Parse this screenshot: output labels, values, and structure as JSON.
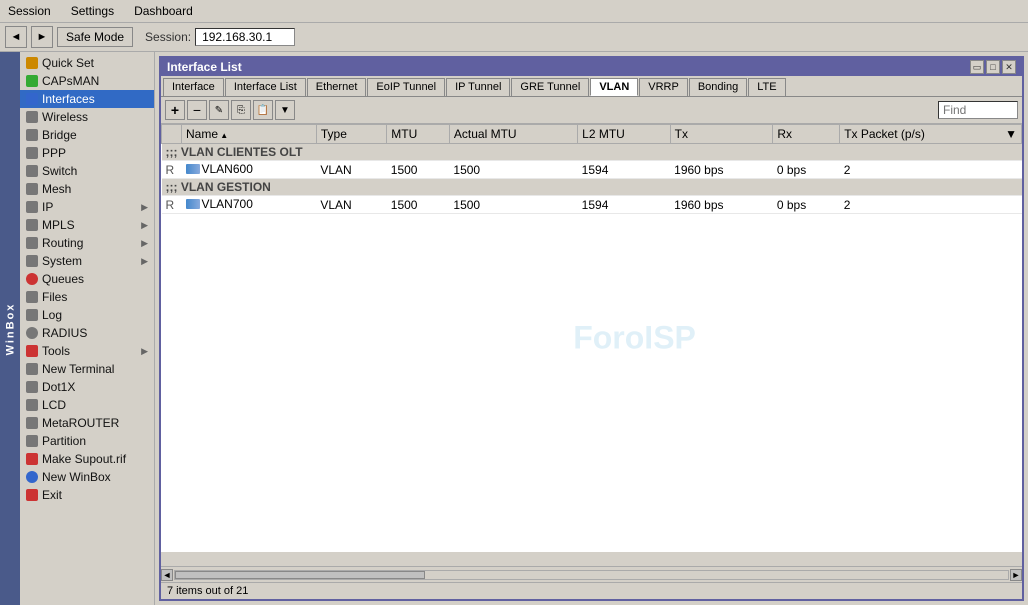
{
  "menuBar": {
    "items": [
      "Session",
      "Settings",
      "Dashboard"
    ]
  },
  "toolbar": {
    "backLabel": "◄",
    "forwardLabel": "►",
    "safeModeLabel": "Safe Mode",
    "sessionLabel": "Session:",
    "sessionValue": "192.168.30.1"
  },
  "sidebar": {
    "items": [
      {
        "id": "quick-set",
        "label": "Quick Set",
        "iconColor": "#cc8800",
        "hasArrow": false
      },
      {
        "id": "capsman",
        "label": "CAPsMAN",
        "iconColor": "#33aa33",
        "hasArrow": false
      },
      {
        "id": "interfaces",
        "label": "Interfaces",
        "iconColor": "#3366cc",
        "hasArrow": false,
        "active": true
      },
      {
        "id": "wireless",
        "label": "Wireless",
        "iconColor": "#888888",
        "hasArrow": false
      },
      {
        "id": "bridge",
        "label": "Bridge",
        "iconColor": "#888888",
        "hasArrow": false
      },
      {
        "id": "ppp",
        "label": "PPP",
        "iconColor": "#888888",
        "hasArrow": false
      },
      {
        "id": "switch",
        "label": "Switch",
        "iconColor": "#888888",
        "hasArrow": false
      },
      {
        "id": "mesh",
        "label": "Mesh",
        "iconColor": "#888888",
        "hasArrow": false
      },
      {
        "id": "ip",
        "label": "IP",
        "iconColor": "#888888",
        "hasArrow": true
      },
      {
        "id": "mpls",
        "label": "MPLS",
        "iconColor": "#888888",
        "hasArrow": true
      },
      {
        "id": "routing",
        "label": "Routing",
        "iconColor": "#888888",
        "hasArrow": true
      },
      {
        "id": "system",
        "label": "System",
        "iconColor": "#888888",
        "hasArrow": true
      },
      {
        "id": "queues",
        "label": "Queues",
        "iconColor": "#cc3333",
        "hasArrow": false
      },
      {
        "id": "files",
        "label": "Files",
        "iconColor": "#888888",
        "hasArrow": false
      },
      {
        "id": "log",
        "label": "Log",
        "iconColor": "#888888",
        "hasArrow": false
      },
      {
        "id": "radius",
        "label": "RADIUS",
        "iconColor": "#888888",
        "hasArrow": false
      },
      {
        "id": "tools",
        "label": "Tools",
        "iconColor": "#888888",
        "hasArrow": true
      },
      {
        "id": "new-terminal",
        "label": "New Terminal",
        "iconColor": "#888888",
        "hasArrow": false
      },
      {
        "id": "dot1x",
        "label": "Dot1X",
        "iconColor": "#888888",
        "hasArrow": false
      },
      {
        "id": "lcd",
        "label": "LCD",
        "iconColor": "#888888",
        "hasArrow": false
      },
      {
        "id": "metarouter",
        "label": "MetaROUTER",
        "iconColor": "#888888",
        "hasArrow": false
      },
      {
        "id": "partition",
        "label": "Partition",
        "iconColor": "#888888",
        "hasArrow": false
      },
      {
        "id": "make-supout",
        "label": "Make Supout.rif",
        "iconColor": "#cc3333",
        "hasArrow": false
      },
      {
        "id": "new-winbox",
        "label": "New WinBox",
        "iconColor": "#3366cc",
        "hasArrow": false
      },
      {
        "id": "exit",
        "label": "Exit",
        "iconColor": "#cc3333",
        "hasArrow": false
      }
    ],
    "winboxLabel": "WinBox"
  },
  "panel": {
    "title": "Interface List",
    "tabs": [
      {
        "id": "interface",
        "label": "Interface"
      },
      {
        "id": "interface-list",
        "label": "Interface List"
      },
      {
        "id": "ethernet",
        "label": "Ethernet"
      },
      {
        "id": "eoip-tunnel",
        "label": "EoIP Tunnel"
      },
      {
        "id": "ip-tunnel",
        "label": "IP Tunnel"
      },
      {
        "id": "gre-tunnel",
        "label": "GRE Tunnel"
      },
      {
        "id": "vlan",
        "label": "VLAN",
        "active": true
      },
      {
        "id": "vrrp",
        "label": "VRRP"
      },
      {
        "id": "bonding",
        "label": "Bonding"
      },
      {
        "id": "lte",
        "label": "LTE"
      }
    ],
    "toolbar": {
      "addLabel": "+",
      "removeLabel": "−",
      "editLabel": "✎",
      "copyLabel": "⎘",
      "pasteLabel": "📋",
      "filterLabel": "▼",
      "findPlaceholder": "Find"
    },
    "tableColumns": [
      "",
      "Name",
      "Type",
      "MTU",
      "Actual MTU",
      "L2 MTU",
      "Tx",
      "Rx",
      "Tx Packet (p/s)"
    ],
    "sections": [
      {
        "header": ";;; VLAN CLIENTES OLT",
        "rows": [
          {
            "flag": "R",
            "name": "VLAN600",
            "type": "VLAN",
            "mtu": "1500",
            "actualMtu": "1500",
            "l2mtu": "1594",
            "tx": "1960 bps",
            "rx": "0 bps",
            "txPacket": "2"
          }
        ]
      },
      {
        "header": ";;; VLAN GESTION",
        "rows": [
          {
            "flag": "R",
            "name": "VLAN700",
            "type": "VLAN",
            "mtu": "1500",
            "actualMtu": "1500",
            "l2mtu": "1594",
            "tx": "1960 bps",
            "rx": "0 bps",
            "txPacket": "2"
          }
        ]
      }
    ],
    "watermark": "ForoISP",
    "statusBar": "7 items out of 21"
  }
}
